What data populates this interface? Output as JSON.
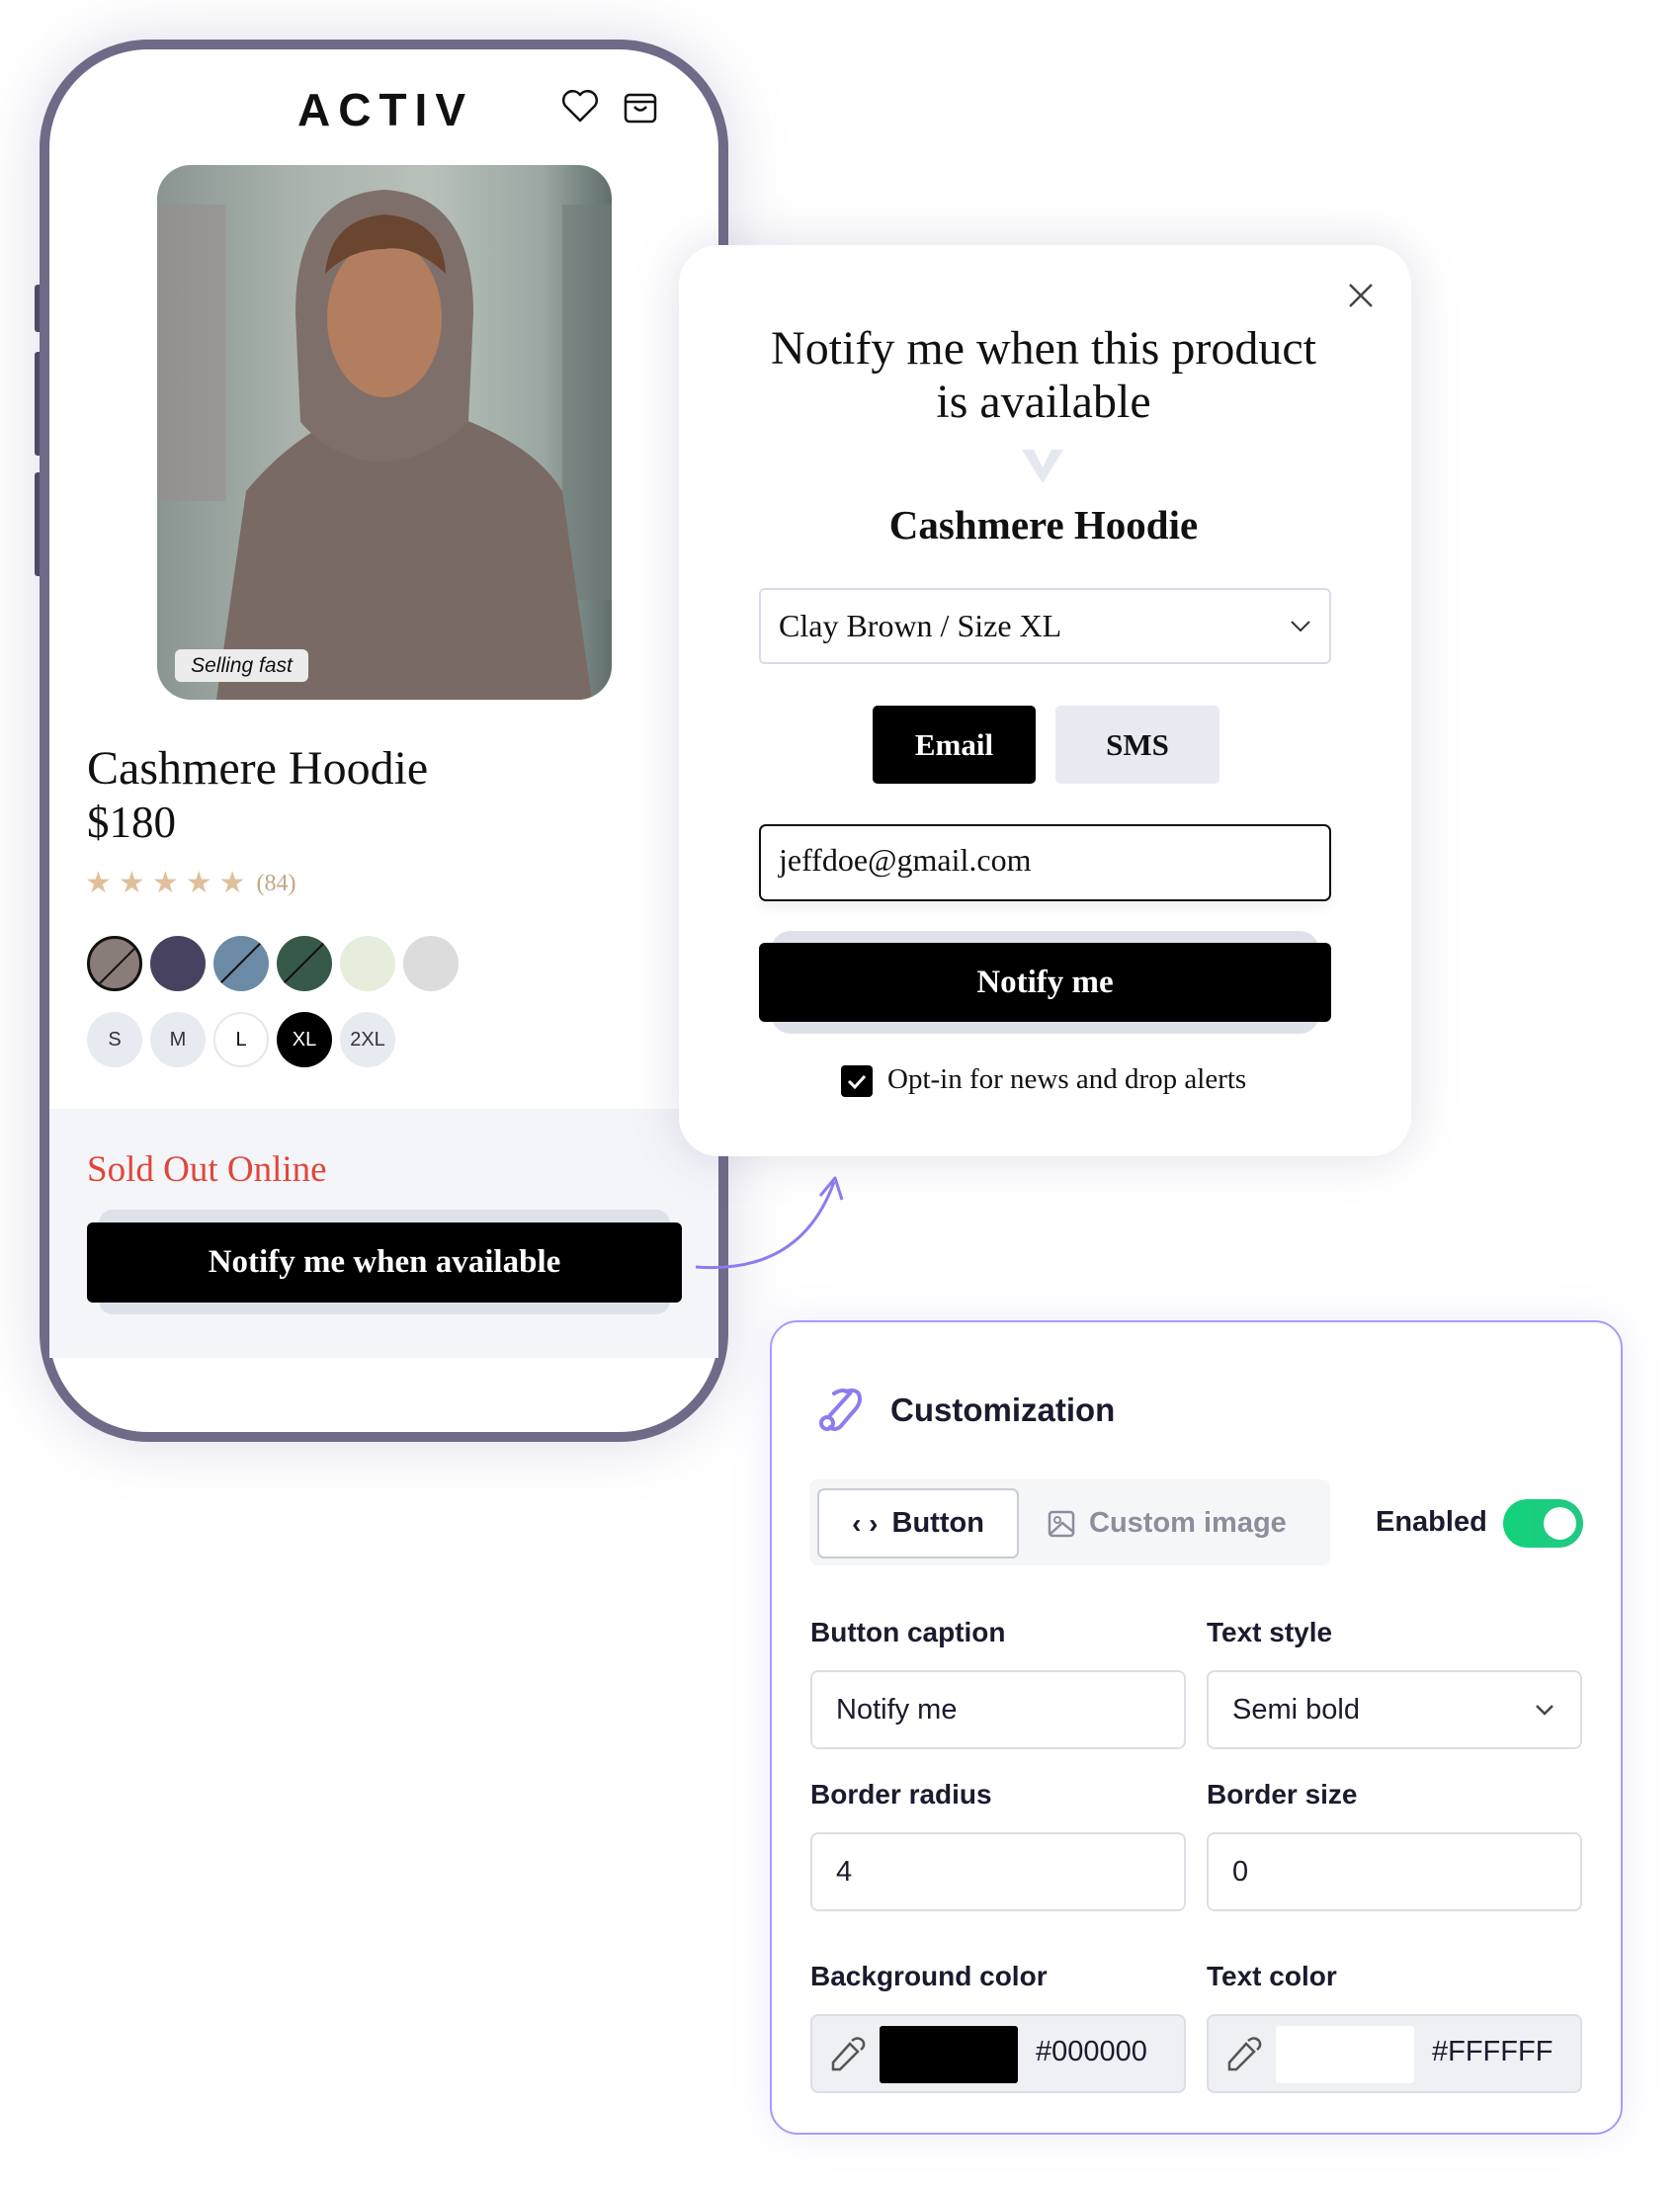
{
  "phone": {
    "logo": "ACTIV",
    "badge": "Selling fast",
    "product_title": "Cashmere Hoodie",
    "price": "$180",
    "rating": 5,
    "review_count": "(84)",
    "star_color": "#e0c09a",
    "swatches": [
      {
        "color": "#8a7c78",
        "selected": true,
        "unavailable": true
      },
      {
        "color": "#46425f",
        "selected": false,
        "unavailable": false
      },
      {
        "color": "#6b8aa6",
        "selected": false,
        "unavailable": true
      },
      {
        "color": "#37594a",
        "selected": false,
        "unavailable": true
      },
      {
        "color": "#e6eddc",
        "selected": false,
        "unavailable": false
      },
      {
        "color": "#dcdcdc",
        "selected": false,
        "unavailable": false
      }
    ],
    "sizes": [
      "S",
      "M",
      "L",
      "XL",
      "2XL"
    ],
    "selected_size": "XL",
    "sold_out": "Sold Out Online",
    "sold_out_color": "#e0463a",
    "notify_button": "Notify me when available"
  },
  "modal": {
    "title_line1": "Notify me when this product",
    "title_line2": "is available",
    "product": "Cashmere Hoodie",
    "variant": "Clay Brown / Size XL",
    "tabs": [
      "Email",
      "SMS"
    ],
    "active_tab": "Email",
    "email_value": "jeffdoe@gmail.com",
    "submit": "Notify me",
    "optin_label": "Opt-in for news and drop alerts",
    "optin_checked": true
  },
  "customization": {
    "title": "Customization",
    "accent": "#8b7cf0",
    "tabs": [
      "Button",
      "Custom image"
    ],
    "active_tab": "Button",
    "enabled_label": "Enabled",
    "enabled": true,
    "toggle_color": "#1ed67a",
    "button_caption_label": "Button caption",
    "button_caption_value": "Notify me",
    "text_style_label": "Text style",
    "text_style_value": "Semi bold",
    "border_radius_label": "Border radius",
    "border_radius_value": "4",
    "border_size_label": "Border size",
    "border_size_value": "0",
    "bg_color_label": "Background color",
    "bg_color_value": "#000000",
    "text_color_label": "Text color",
    "text_color_value": "#FFFFFF"
  }
}
